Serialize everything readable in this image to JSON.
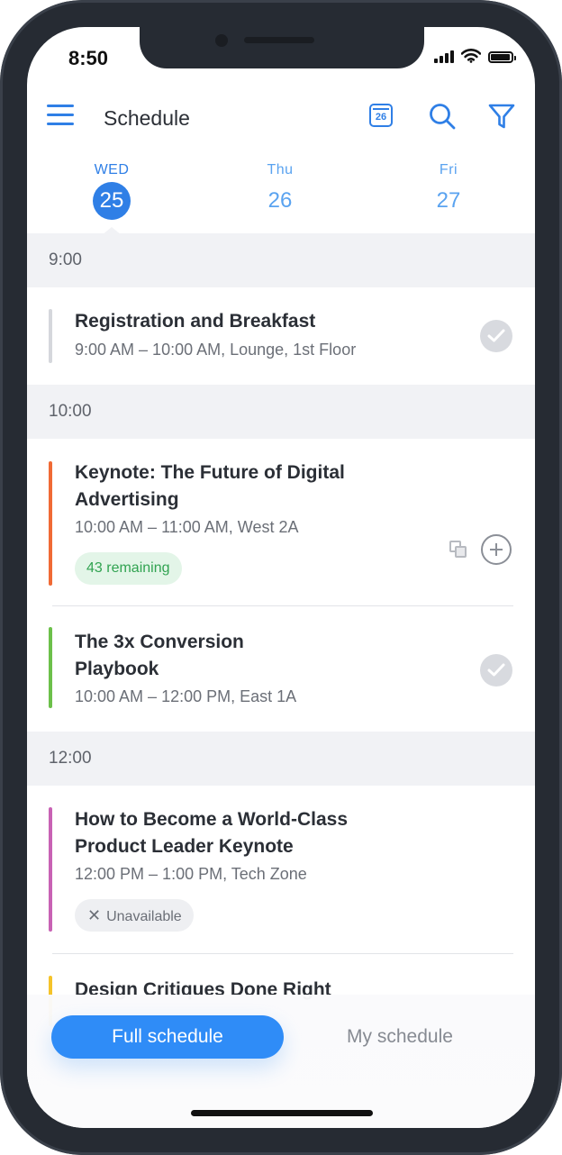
{
  "status": {
    "time": "8:50"
  },
  "header": {
    "title": "Schedule",
    "calendar_day": "26"
  },
  "days": [
    {
      "name": "WED",
      "number": "25",
      "selected": true
    },
    {
      "name": "Thu",
      "number": "26",
      "selected": false
    },
    {
      "name": "Fri",
      "number": "27",
      "selected": false
    }
  ],
  "sections": [
    {
      "time": "9:00",
      "events": [
        {
          "title": "Registration and Breakfast",
          "details": "9:00 AM – 10:00 AM, Lounge, 1st Floor",
          "color": "#d5d7dc",
          "status": "added"
        }
      ]
    },
    {
      "time": "10:00",
      "events": [
        {
          "title_lines": [
            "Keynote: The Future of Digital",
            "Advertising"
          ],
          "details": "10:00 AM – 11:00 AM, West 2A",
          "color": "#f06a35",
          "badge": "43 remaining",
          "action": "add"
        },
        {
          "title_lines": [
            "The 3x Conversion",
            "Playbook"
          ],
          "details": "10:00 AM – 12:00 PM, East 1A",
          "color": "#6cc04a",
          "status": "added"
        }
      ]
    },
    {
      "time": "12:00",
      "events": [
        {
          "title_lines": [
            "How to Become a World-Class",
            "Product Leader Keynote"
          ],
          "details": "12:00 PM – 1:00 PM, Tech Zone",
          "color": "#c862b4",
          "badge": "Unavailable"
        },
        {
          "title": "Design Critiques Done Right",
          "color": "#f5c32a"
        }
      ]
    }
  ],
  "bottom_tabs": {
    "full": "Full schedule",
    "mine": "My schedule",
    "active": "full"
  },
  "colors": {
    "accent": "#2f7fe6",
    "primary_button": "#2f8cf7"
  }
}
